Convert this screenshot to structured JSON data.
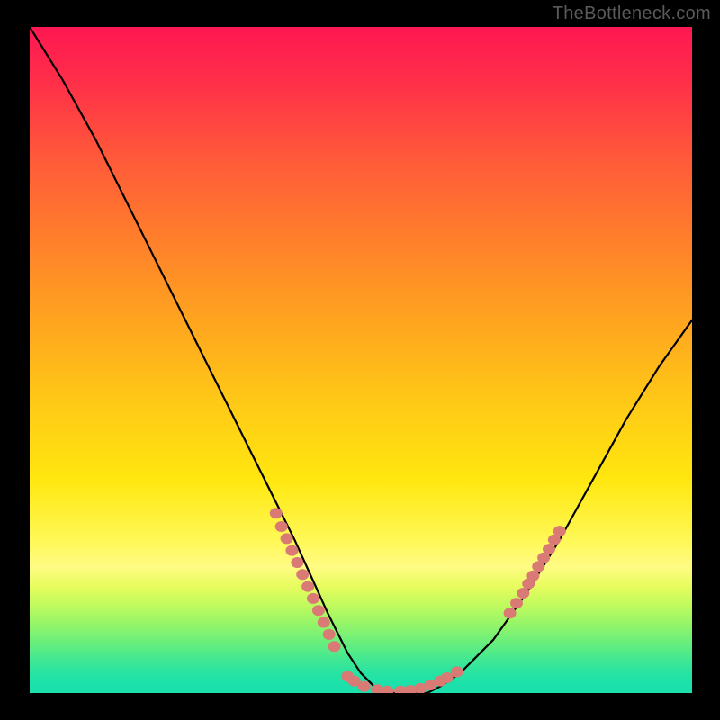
{
  "watermark": "TheBottleneck.com",
  "chart_data": {
    "type": "line",
    "title": "",
    "xlabel": "",
    "ylabel": "",
    "xlim": [
      0,
      100
    ],
    "ylim": [
      0,
      100
    ],
    "grid": false,
    "legend": false,
    "series": [
      {
        "name": "bottleneck-curve",
        "color": "#000000",
        "x": [
          0,
          5,
          10,
          15,
          20,
          25,
          30,
          35,
          40,
          45,
          48,
          50,
          52,
          55,
          58,
          60,
          62,
          65,
          70,
          75,
          80,
          85,
          90,
          95,
          100
        ],
        "y": [
          100,
          92,
          83,
          73,
          63,
          53,
          43,
          33,
          23,
          12,
          6,
          3,
          1,
          0,
          0,
          0,
          1,
          3,
          8,
          15,
          23,
          32,
          41,
          49,
          56
        ]
      },
      {
        "name": "left-dot-cluster",
        "color": "#d97a74",
        "style": "scatter",
        "x": [
          37.2,
          38.0,
          38.8,
          39.6,
          40.4,
          41.2,
          42.0,
          42.8,
          43.6,
          44.4,
          45.2,
          46.0
        ],
        "y": [
          27.0,
          25.0,
          23.2,
          21.4,
          19.6,
          17.8,
          16.0,
          14.2,
          12.4,
          10.6,
          8.8,
          7.0
        ]
      },
      {
        "name": "bottom-dot-cluster",
        "color": "#d97a74",
        "style": "scatter",
        "x": [
          48.0,
          49.0,
          50.5,
          52.5,
          54.0,
          56.0,
          57.5,
          59.0,
          60.5,
          62.0,
          63.0,
          64.5
        ],
        "y": [
          2.5,
          1.8,
          1.0,
          0.5,
          0.3,
          0.3,
          0.4,
          0.7,
          1.2,
          1.8,
          2.3,
          3.2
        ]
      },
      {
        "name": "right-dot-cluster",
        "color": "#d97a74",
        "style": "scatter",
        "x": [
          72.5,
          73.5,
          74.5,
          75.3,
          76.0,
          76.8,
          77.6,
          78.4,
          79.2,
          80.0
        ],
        "y": [
          12.0,
          13.5,
          15.0,
          16.4,
          17.6,
          19.0,
          20.3,
          21.6,
          23.0,
          24.3
        ]
      }
    ],
    "gradient_background": {
      "direction": "vertical",
      "stops": [
        {
          "pos": 0.0,
          "color": "#ff1752"
        },
        {
          "pos": 0.5,
          "color": "#ffc817"
        },
        {
          "pos": 0.8,
          "color": "#fffb84"
        },
        {
          "pos": 1.0,
          "color": "#1ae0ac"
        }
      ]
    }
  }
}
